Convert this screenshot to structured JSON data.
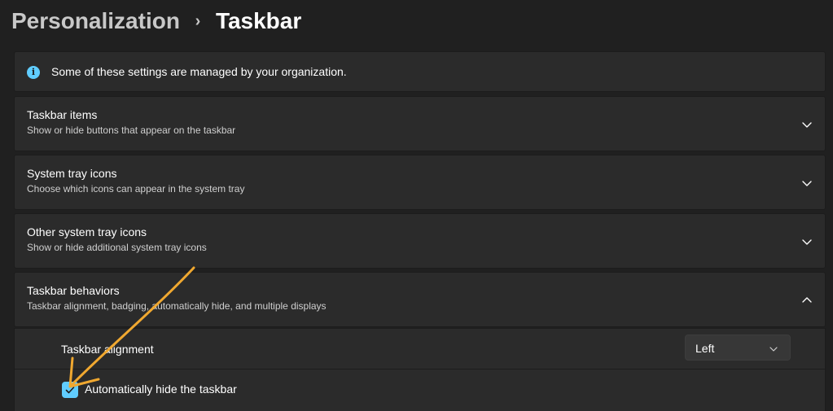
{
  "breadcrumb": {
    "parent": "Personalization",
    "separator": "›",
    "current": "Taskbar"
  },
  "info_banner": {
    "icon": "info-icon",
    "icon_glyph": "i",
    "text": "Some of these settings are managed by your organization."
  },
  "sections": [
    {
      "title": "Taskbar items",
      "description": "Show or hide buttons that appear on the taskbar",
      "expanded": false
    },
    {
      "title": "System tray icons",
      "description": "Choose which icons can appear in the system tray",
      "expanded": false
    },
    {
      "title": "Other system tray icons",
      "description": "Show or hide additional system tray icons",
      "expanded": false
    },
    {
      "title": "Taskbar behaviors",
      "description": "Taskbar alignment, badging, automatically hide, and multiple displays",
      "expanded": true
    }
  ],
  "taskbar_behaviors": {
    "alignment_label": "Taskbar alignment",
    "alignment_value": "Left",
    "autohide_label": "Automatically hide the taskbar",
    "autohide_checked": true
  },
  "colors": {
    "background": "#202020",
    "card": "#2b2b2b",
    "accent": "#60cdff",
    "annotation": "#f0a830"
  }
}
